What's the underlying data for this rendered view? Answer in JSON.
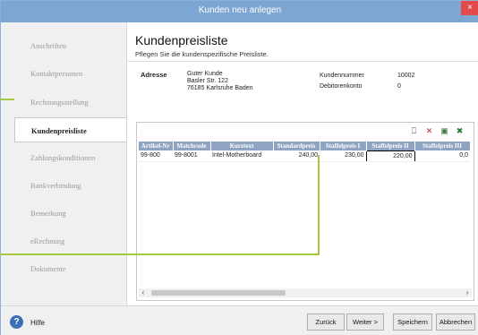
{
  "window": {
    "title": "Kunden neu anlegen",
    "close_glyph": "×"
  },
  "sidebar": {
    "items": [
      {
        "label": "Anschriften",
        "active": false
      },
      {
        "label": "Kontaktpersonen",
        "active": false
      },
      {
        "label": "Rechnungsstellung",
        "active": false
      },
      {
        "label": "Kundenpreisliste",
        "active": true
      },
      {
        "label": "Zahlungskonditionen",
        "active": false
      },
      {
        "label": "Bankverbindung",
        "active": false
      },
      {
        "label": "Bemerkung",
        "active": false
      },
      {
        "label": "eRechnung",
        "active": false
      },
      {
        "label": "Dokumente",
        "active": false
      }
    ]
  },
  "main": {
    "title": "Kundenpreisliste",
    "subtitle": "Pflegen Sie die kundenspezifische Preisliste.",
    "address": {
      "label": "Adresse",
      "lines": [
        "Guter Kunde",
        "Basler Str.  122",
        "76185  Karlsruhe Baden"
      ],
      "customer_number_label": "Kundennummer",
      "customer_number": "10002",
      "debtor_account_label": "Debitorenkonto",
      "debtor_account": "0"
    },
    "toolbar": [
      {
        "name": "new-icon",
        "glyph": "⎕",
        "color": "#4a4a4a"
      },
      {
        "name": "delete-icon",
        "glyph": "✕",
        "color": "#c8232c"
      },
      {
        "name": "edit-icon",
        "glyph": "▣",
        "color": "#3a7a3a"
      },
      {
        "name": "excel-icon",
        "glyph": "✖",
        "color": "#1f7a3a"
      }
    ],
    "table": {
      "columns": [
        "Artikel-Nr",
        "Matchcode",
        "Kurztext",
        "Standardpreis",
        "Staffelpreis I",
        "Staffelpreis II",
        "Staffelpreis III"
      ],
      "rows": [
        [
          "99-800",
          "99-8001",
          "Intel-Motherboard",
          "240,00",
          "230,00",
          "220,00",
          "0,0"
        ]
      ]
    },
    "scroll": {
      "left": "‹",
      "right": "›"
    }
  },
  "footer": {
    "help_label": "Hilfe",
    "help_glyph": "?",
    "buttons": {
      "back": "Zurück",
      "next": "Weiter >",
      "save": "Speichern",
      "cancel": "Abbrechen"
    }
  },
  "colors": {
    "titlebar": "#7ea6d3",
    "table_header": "#8fa3c2",
    "callout": "#a6c83c"
  }
}
